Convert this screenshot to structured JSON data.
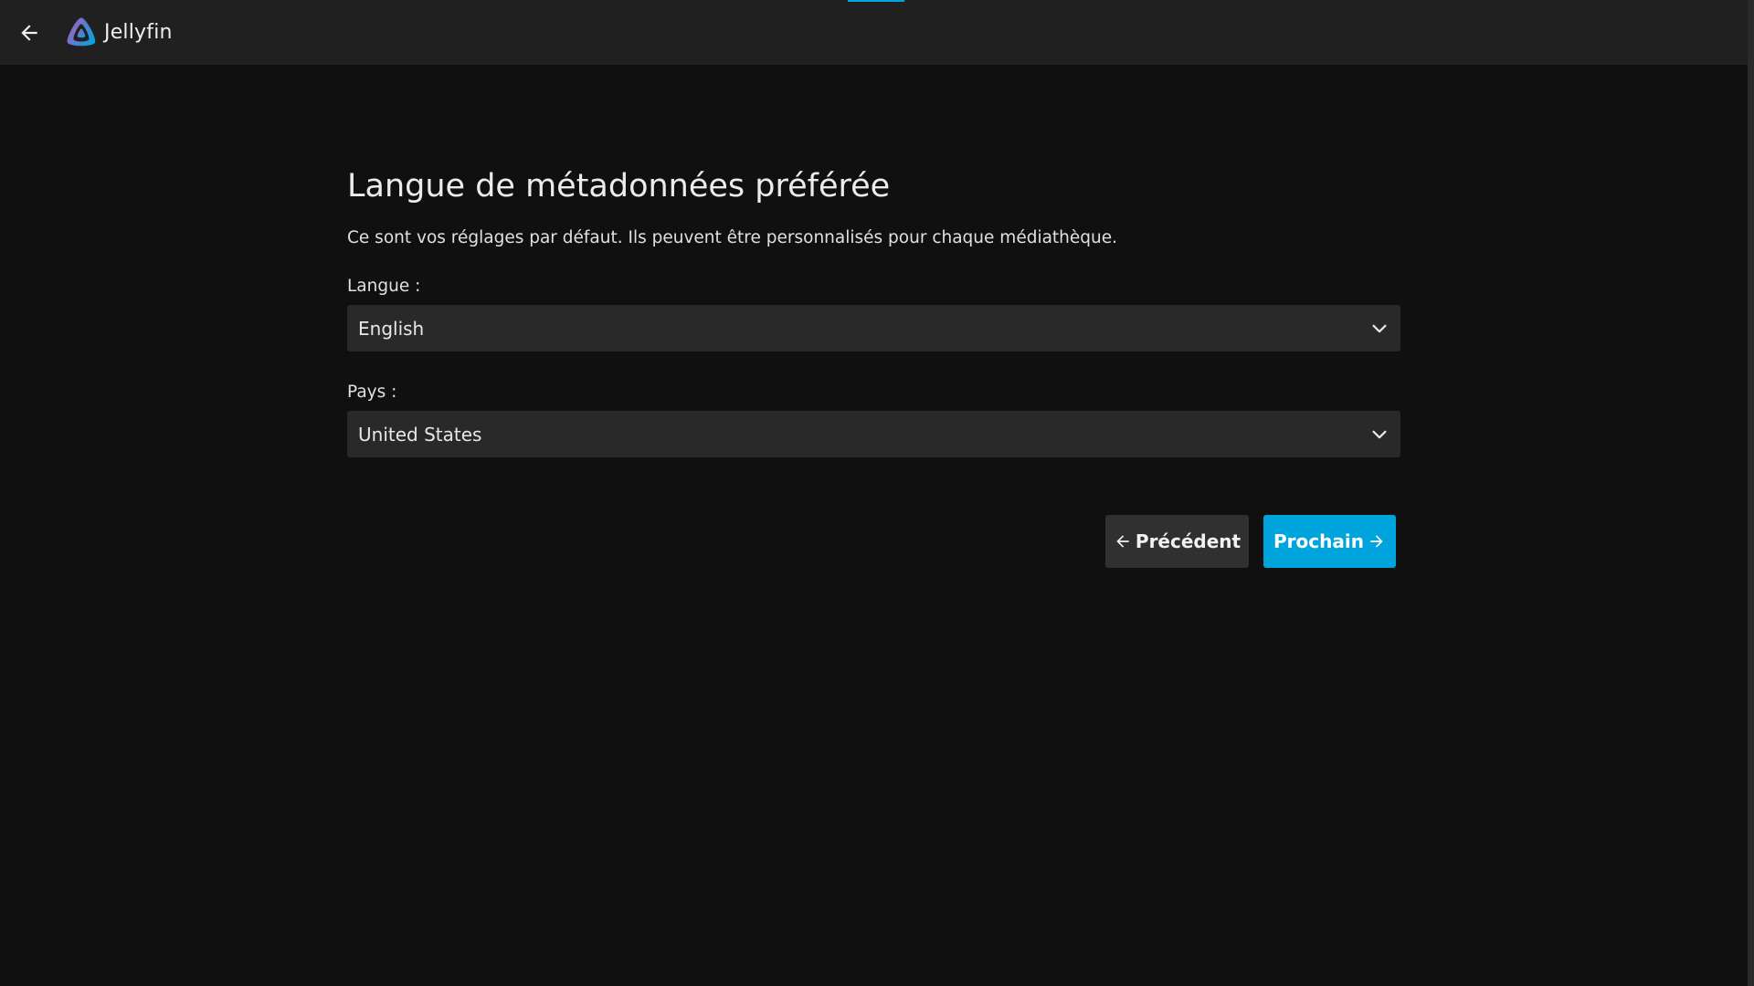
{
  "header": {
    "app_name": "Jellyfin",
    "back_icon": "arrow-left-icon",
    "logo_icon": "jellyfin-logo-icon",
    "accent_color": "#00a4dc"
  },
  "wizard": {
    "title": "Langue de métadonnées préférée",
    "description": "Ce sont vos réglages par défaut. Ils peuvent être personnalisés pour chaque médiathèque.",
    "language": {
      "label": "Langue :",
      "value": "English",
      "icon": "chevron-down-icon"
    },
    "country": {
      "label": "Pays :",
      "value": "United States",
      "icon": "chevron-down-icon"
    },
    "buttons": {
      "previous": "Précédent",
      "next": "Prochain",
      "previous_icon": "arrow-left-icon",
      "next_icon": "arrow-right-icon"
    }
  }
}
